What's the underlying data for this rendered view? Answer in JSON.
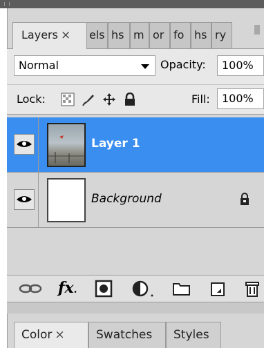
{
  "layers_panel": {
    "tabs": [
      {
        "label": "Layers",
        "active": true,
        "close": "×"
      },
      {
        "label": "els"
      },
      {
        "label": "hs"
      },
      {
        "label": "m"
      },
      {
        "label": "or"
      },
      {
        "label": "fo"
      },
      {
        "label": "hs"
      },
      {
        "label": "ry"
      }
    ],
    "blend_mode": "Normal",
    "opacity_label": "Opacity:",
    "opacity_value": "100%",
    "lock_label": "Lock:",
    "fill_label": "Fill:",
    "fill_value": "100%",
    "layers": [
      {
        "name": "Layer 1",
        "selected": true,
        "visible": true,
        "thumbnail": "photo"
      },
      {
        "name": "Background",
        "selected": false,
        "visible": true,
        "locked": true,
        "thumbnail": "white"
      }
    ],
    "toolbar_icons": [
      "link-icon",
      "fx-icon",
      "mask-icon",
      "adjustment-icon",
      "group-icon",
      "new-layer-icon",
      "trash-icon"
    ],
    "fx_label": "fx",
    "selection_color": "#3a8ef0"
  },
  "lower_panel": {
    "tabs": [
      {
        "label": "Color",
        "active": true,
        "close": "×"
      },
      {
        "label": "Swatches"
      },
      {
        "label": "Styles"
      }
    ]
  }
}
